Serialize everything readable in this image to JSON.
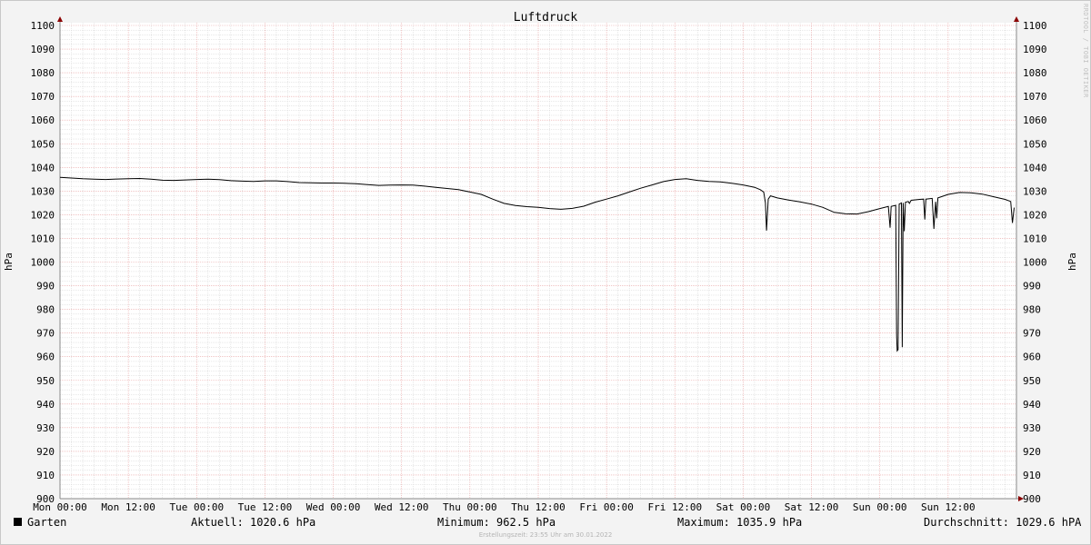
{
  "chart_data": {
    "type": "line",
    "title": "Luftdruck",
    "ylabel": "hPa",
    "ylabel_right": "hPa",
    "ylim": [
      900,
      1100
    ],
    "y_step": 10,
    "y_ticks": [
      "900",
      "910",
      "920",
      "930",
      "940",
      "950",
      "960",
      "970",
      "980",
      "990",
      "1000",
      "1010",
      "1020",
      "1030",
      "1040",
      "1050",
      "1060",
      "1070",
      "1080",
      "1090",
      "1100"
    ],
    "x_ticks": [
      "Mon 00:00",
      "Mon 12:00",
      "Tue 00:00",
      "Tue 12:00",
      "Wed 00:00",
      "Wed 12:00",
      "Thu 00:00",
      "Thu 12:00",
      "Fri 00:00",
      "Fri 12:00",
      "Sat 00:00",
      "Sat 12:00",
      "Sun 00:00",
      "Sun 12:00"
    ],
    "x_unit": "hours since Mon 00:00",
    "xlim": [
      0,
      168
    ],
    "grid": true,
    "series": [
      {
        "name": "Garten",
        "color": "#000000",
        "points": [
          [
            0,
            1035.8
          ],
          [
            2,
            1035.5
          ],
          [
            4,
            1035.2
          ],
          [
            6,
            1035.0
          ],
          [
            8,
            1034.9
          ],
          [
            10,
            1035.1
          ],
          [
            12,
            1035.2
          ],
          [
            14,
            1035.3
          ],
          [
            16,
            1035.0
          ],
          [
            18,
            1034.6
          ],
          [
            20,
            1034.5
          ],
          [
            22,
            1034.7
          ],
          [
            24,
            1034.9
          ],
          [
            26,
            1035.0
          ],
          [
            28,
            1034.8
          ],
          [
            30,
            1034.4
          ],
          [
            32,
            1034.2
          ],
          [
            34,
            1034.1
          ],
          [
            36,
            1034.3
          ],
          [
            38,
            1034.3
          ],
          [
            40,
            1034.0
          ],
          [
            42,
            1033.6
          ],
          [
            44,
            1033.5
          ],
          [
            46,
            1033.4
          ],
          [
            48,
            1033.4
          ],
          [
            50,
            1033.3
          ],
          [
            52,
            1033.1
          ],
          [
            54,
            1032.7
          ],
          [
            56,
            1032.4
          ],
          [
            58,
            1032.5
          ],
          [
            60,
            1032.6
          ],
          [
            62,
            1032.5
          ],
          [
            64,
            1032.1
          ],
          [
            66,
            1031.6
          ],
          [
            68,
            1031.1
          ],
          [
            70,
            1030.6
          ],
          [
            72,
            1029.6
          ],
          [
            74,
            1028.6
          ],
          [
            76,
            1026.6
          ],
          [
            78,
            1024.8
          ],
          [
            80,
            1023.9
          ],
          [
            82,
            1023.4
          ],
          [
            84,
            1023.1
          ],
          [
            86,
            1022.6
          ],
          [
            88,
            1022.3
          ],
          [
            90,
            1022.7
          ],
          [
            92,
            1023.6
          ],
          [
            94,
            1025.3
          ],
          [
            96,
            1026.6
          ],
          [
            98,
            1028.0
          ],
          [
            100,
            1029.6
          ],
          [
            102,
            1031.2
          ],
          [
            104,
            1032.6
          ],
          [
            106,
            1034.0
          ],
          [
            108,
            1034.9
          ],
          [
            110,
            1035.2
          ],
          [
            112,
            1034.5
          ],
          [
            114,
            1034.1
          ],
          [
            116,
            1033.9
          ],
          [
            118,
            1033.3
          ],
          [
            120,
            1032.6
          ],
          [
            122,
            1031.6
          ],
          [
            123,
            1030.6
          ],
          [
            123.6,
            1029.6
          ],
          [
            123.9,
            1025.0
          ],
          [
            124.1,
            1013.3
          ],
          [
            124.4,
            1026.6
          ],
          [
            124.8,
            1028.0
          ],
          [
            126,
            1027.1
          ],
          [
            128,
            1026.2
          ],
          [
            130,
            1025.4
          ],
          [
            132,
            1024.5
          ],
          [
            134,
            1023.1
          ],
          [
            136,
            1021.0
          ],
          [
            138,
            1020.4
          ],
          [
            140,
            1020.3
          ],
          [
            142,
            1021.3
          ],
          [
            144,
            1022.6
          ],
          [
            145.5,
            1023.5
          ],
          [
            145.8,
            1014.5
          ],
          [
            146,
            1023.5
          ],
          [
            146.8,
            1024.0
          ],
          [
            146.95,
            969.0
          ],
          [
            147.05,
            962.5
          ],
          [
            147.2,
            963.0
          ],
          [
            147.4,
            1024.5
          ],
          [
            147.8,
            1025.0
          ],
          [
            147.95,
            964.0
          ],
          [
            148.1,
            1025.0
          ],
          [
            148.3,
            1013.0
          ],
          [
            148.5,
            1025.3
          ],
          [
            149,
            1025.6
          ],
          [
            149.2,
            1024.8
          ],
          [
            149.5,
            1026.1
          ],
          [
            151,
            1026.5
          ],
          [
            151.7,
            1026.6
          ],
          [
            151.9,
            1018.0
          ],
          [
            152.1,
            1026.6
          ],
          [
            153.2,
            1026.9
          ],
          [
            153.5,
            1014.0
          ],
          [
            153.8,
            1025.5
          ],
          [
            154,
            1018.5
          ],
          [
            154.2,
            1027.1
          ],
          [
            156,
            1028.6
          ],
          [
            158,
            1029.4
          ],
          [
            160,
            1029.3
          ],
          [
            162,
            1028.7
          ],
          [
            164,
            1027.6
          ],
          [
            166,
            1026.5
          ],
          [
            167,
            1025.6
          ],
          [
            167.3,
            1016.5
          ],
          [
            167.6,
            1023.0
          ]
        ]
      }
    ],
    "stats": {
      "current": "Aktuell: 1020.6 hPa",
      "minimum": "Minimum: 962.5 hPa",
      "maximum": "Maximum: 1035.9 hPa",
      "average": "Durchschnitt: 1029.6 hPA"
    }
  },
  "legend_label": "Garten",
  "footer": "Erstellungszeit: 23:55 Uhr am 30.01.2022",
  "watermark": "RRDTOOL / TOBI OETIKER",
  "colors": {
    "background": "#f3f3f3",
    "plot_bg": "#ffffff",
    "grid_major": "#e8a0a0",
    "grid_minor": "#d0d0d0",
    "axis_arrow": "#8b0000",
    "line": "#000000"
  }
}
